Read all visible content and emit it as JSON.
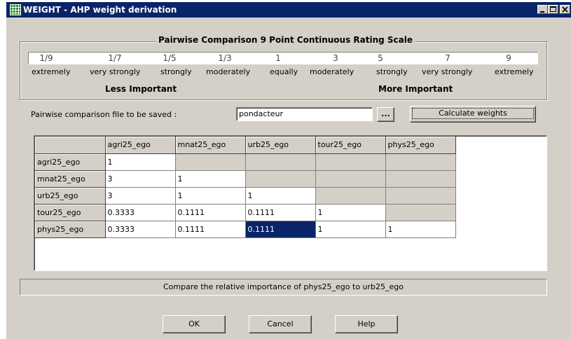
{
  "window": {
    "title": "WEIGHT - AHP weight derivation"
  },
  "scale": {
    "title": "Pairwise Comparison 9 Point Continuous Rating Scale",
    "values": [
      "1/9",
      "1/7",
      "1/5",
      "1/3",
      "1",
      "3",
      "5",
      "7",
      "9"
    ],
    "descriptors": [
      "extremely",
      "very strongly",
      "strongly",
      "moderately",
      "equally",
      "moderately",
      "strongly",
      "very strongly",
      "extremely"
    ],
    "less_label": "Less Important",
    "more_label": "More Important"
  },
  "file": {
    "label": "Pairwise comparison file to be saved :",
    "value": "pondacteur",
    "browse_label": "...",
    "calculate_label": "Calculate weights"
  },
  "grid": {
    "columns": [
      "agri25_ego",
      "mnat25_ego",
      "urb25_ego",
      "tour25_ego",
      "phys25_ego"
    ],
    "rows": [
      {
        "label": "agri25_ego",
        "cells": [
          "1",
          "",
          "",
          "",
          ""
        ]
      },
      {
        "label": "mnat25_ego",
        "cells": [
          "3",
          "1",
          "",
          "",
          ""
        ]
      },
      {
        "label": "urb25_ego",
        "cells": [
          "3",
          "1",
          "1",
          "",
          ""
        ]
      },
      {
        "label": "tour25_ego",
        "cells": [
          "0.3333",
          "0.1111",
          "0.1111",
          "1",
          ""
        ]
      },
      {
        "label": "phys25_ego",
        "cells": [
          "0.3333",
          "0.1111",
          "0.1111",
          "1",
          "1"
        ]
      }
    ],
    "selected": {
      "row": 4,
      "col": 2
    }
  },
  "status": {
    "text": "Compare the relative importance of phys25_ego to urb25_ego"
  },
  "buttons": {
    "ok": "OK",
    "cancel": "Cancel",
    "help": "Help"
  },
  "colors": {
    "title_bar": "#0a246a",
    "face": "#d4d0c8",
    "selection": "#0a246a"
  }
}
